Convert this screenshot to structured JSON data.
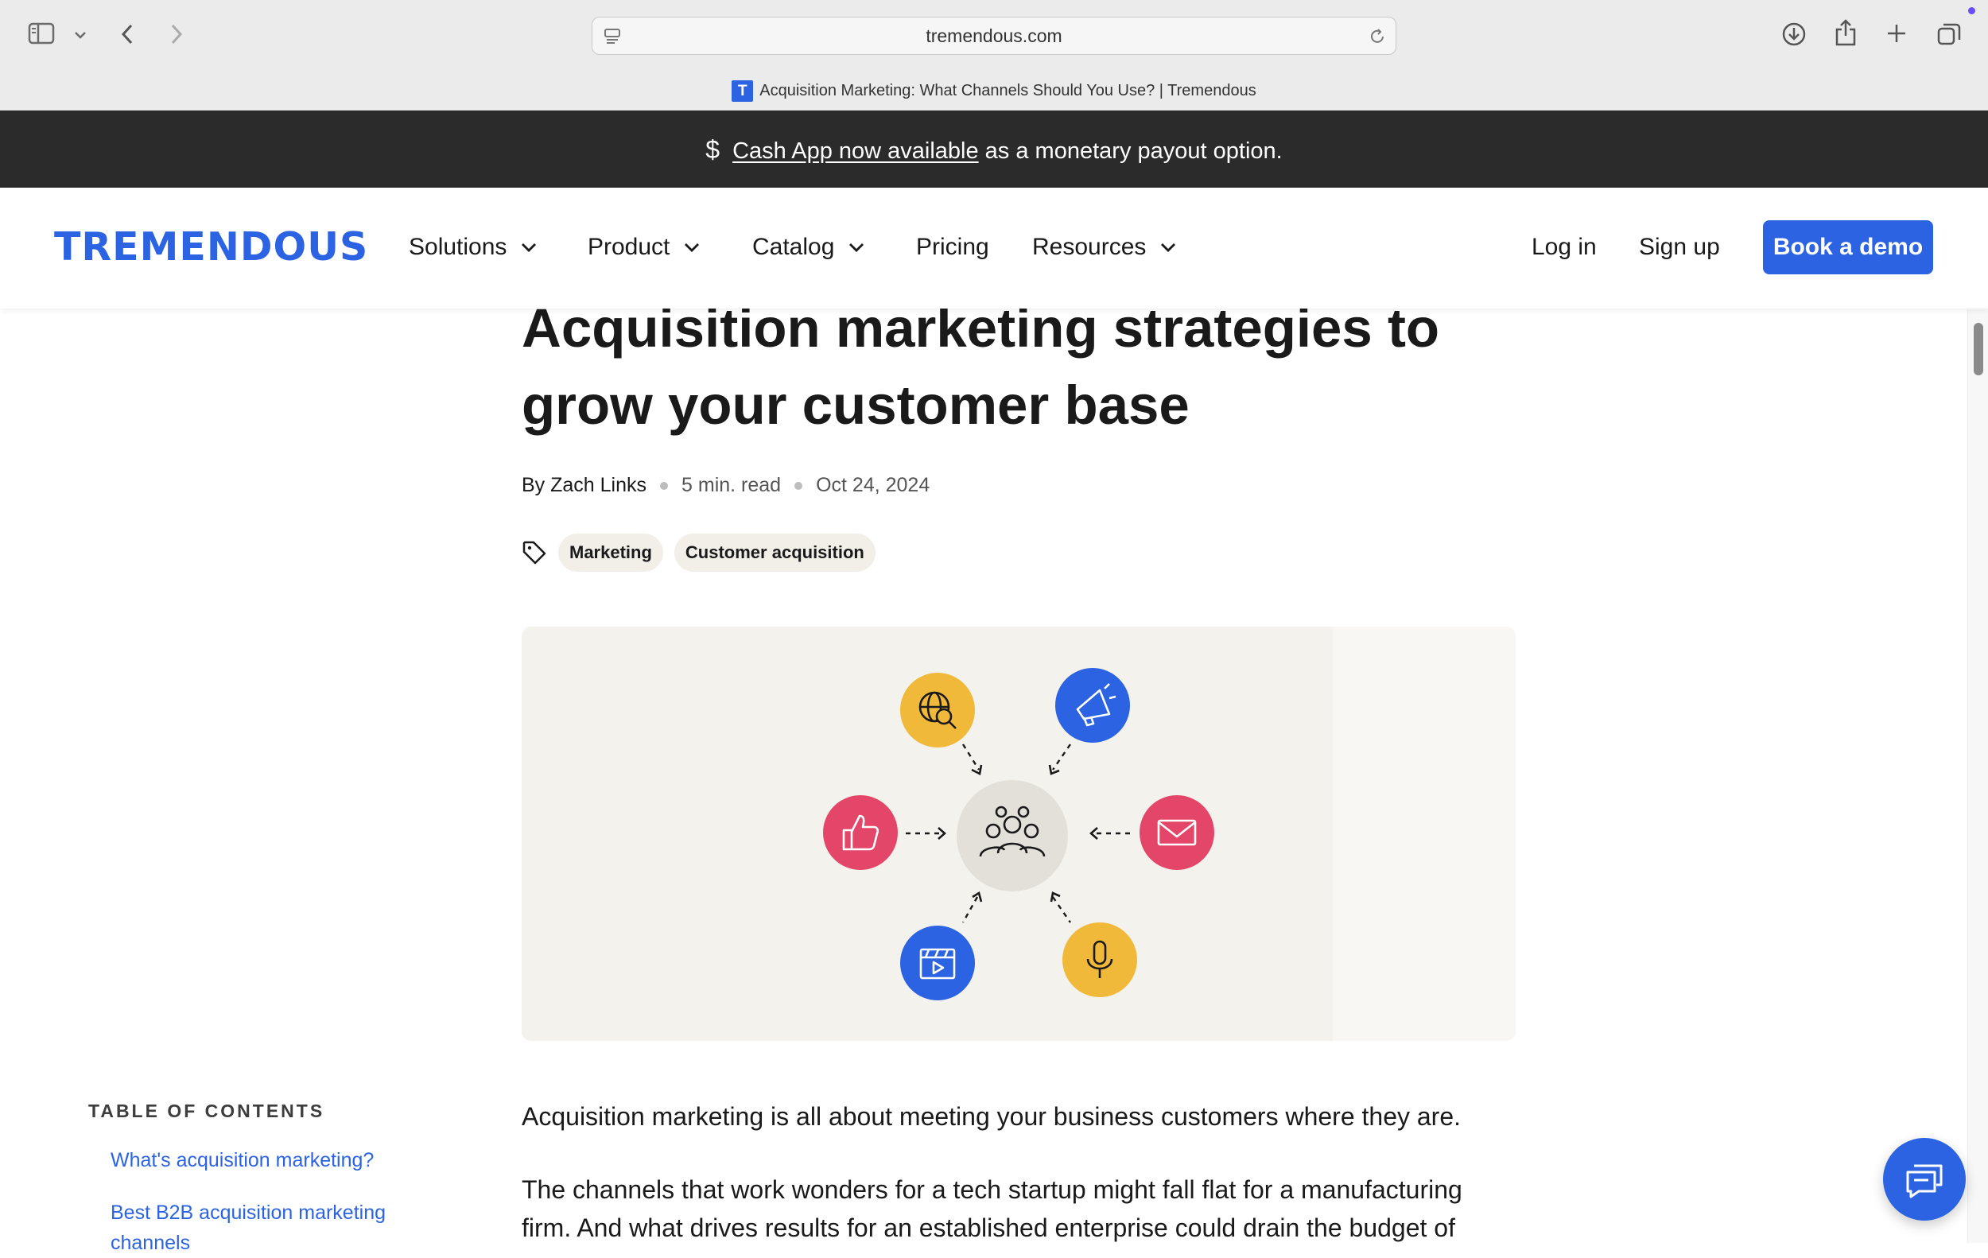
{
  "browser": {
    "url": "tremendous.com",
    "tab_title": "Acquisition Marketing: What Channels Should You Use? | Tremendous",
    "favicon_letter": "T",
    "icons": [
      "sidebar-icon",
      "chevron-down-icon",
      "back-icon",
      "forward-icon",
      "page-menu-icon",
      "reload-icon",
      "download-icon",
      "share-icon",
      "new-tab-icon",
      "tabs-overview-icon"
    ]
  },
  "announcement": {
    "icon": "dollar-icon",
    "link_text": "Cash App now available",
    "rest_text": " as a monetary payout option."
  },
  "nav": {
    "logo": "TREMENDOUS",
    "items": [
      {
        "label": "Solutions",
        "has_dropdown": true
      },
      {
        "label": "Product",
        "has_dropdown": true
      },
      {
        "label": "Catalog",
        "has_dropdown": true
      },
      {
        "label": "Pricing",
        "has_dropdown": false
      },
      {
        "label": "Resources",
        "has_dropdown": true
      }
    ],
    "login": "Log in",
    "signup": "Sign up",
    "cta": "Book a demo"
  },
  "article": {
    "title": "Acquisition marketing strategies to grow your customer base",
    "author": "By Zach Links",
    "read_time": "5 min. read",
    "date": "Oct 24, 2024",
    "tags": [
      "Marketing",
      "Customer acquisition"
    ],
    "hero_icons": [
      "global-search-icon",
      "megaphone-icon",
      "thumbs-up-icon",
      "audience-icon",
      "email-icon",
      "video-icon",
      "microphone-icon"
    ],
    "paragraphs": [
      "Acquisition marketing is all about meeting your business customers where they are.",
      "The channels that work wonders for a tech startup might fall flat for a manufacturing firm. And what drives results for an established enterprise could drain the budget of"
    ]
  },
  "toc": {
    "heading": "TABLE OF CONTENTS",
    "items": [
      "What's acquisition marketing?",
      "Best B2B acquisition marketing channels"
    ]
  },
  "colors": {
    "brand_blue": "#2b63e3",
    "announce_bg": "#2b2b2b",
    "hero_bg": "#f4f2ec",
    "yellow": "#f0b93a",
    "pink": "#e34668"
  }
}
